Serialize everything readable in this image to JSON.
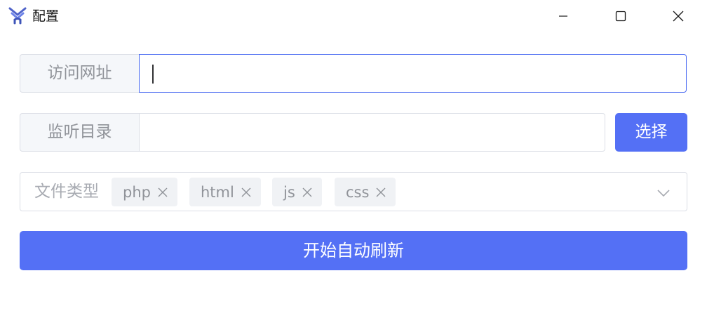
{
  "window": {
    "title": "配置",
    "controls": [
      "minimize-icon",
      "maximize-icon",
      "close-icon"
    ]
  },
  "form": {
    "url": {
      "label": "访问网址",
      "value": ""
    },
    "directory": {
      "label": "监听目录",
      "value": "",
      "button_label": "选择"
    },
    "file_types": {
      "label": "文件类型",
      "tags": [
        "php",
        "html",
        "js",
        "css"
      ]
    },
    "submit_label": "开始自动刷新"
  },
  "colors": {
    "primary": "#5470f5",
    "focus_border": "#4e6ef2",
    "border": "#dcdfe6",
    "label_bg": "#f5f7fa",
    "tag_bg": "#f0f2f5"
  }
}
